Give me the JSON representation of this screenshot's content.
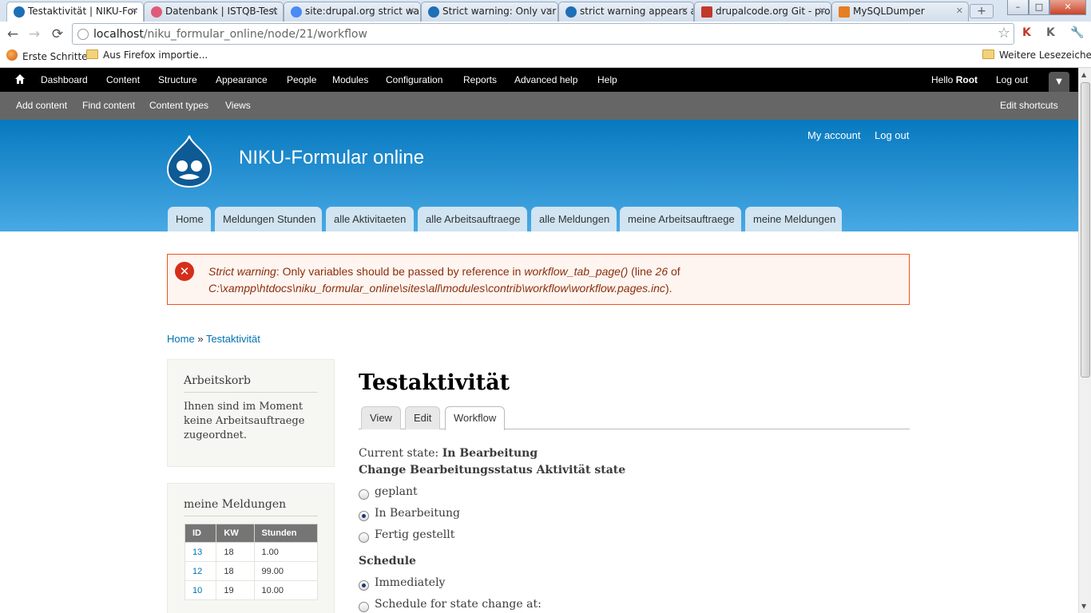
{
  "browser": {
    "tabs": [
      {
        "title": "Testaktivität | NIKU-For",
        "color": "#1e6fb5",
        "active": true
      },
      {
        "title": "Datenbank | ISTQB-Test",
        "color": "#e05a7a",
        "active": false
      },
      {
        "title": "site:drupal.org strict wa",
        "color": "#4a8af4",
        "active": false
      },
      {
        "title": "Strict warning: Only var",
        "color": "#1e6fb5",
        "active": false
      },
      {
        "title": "strict warning appears a",
        "color": "#1e6fb5",
        "active": false
      },
      {
        "title": "drupalcode.org Git - pro",
        "color": "#c0392b",
        "active": false
      },
      {
        "title": "MySQLDumper",
        "color": "#e67e22",
        "active": false
      }
    ],
    "new_tab": "+",
    "window": {
      "minimize": "–",
      "maximize": "□",
      "close": "✕"
    },
    "nav": {
      "back": "←",
      "forward": "→",
      "reload": "⟳"
    },
    "address": {
      "host": "localhost",
      "path": "/niku_formular_online/node/21/workflow"
    },
    "bookmarks": [
      "Erste Schritte",
      "Aus Firefox importie...",
      "Weitere Lesezeichen"
    ]
  },
  "admin_toolbar": {
    "items": [
      "Dashboard",
      "Content",
      "Structure",
      "Appearance",
      "People",
      "Modules",
      "Configuration",
      "Reports",
      "Advanced help",
      "Help"
    ],
    "hello": "Hello",
    "user": "Root",
    "logout": "Log out",
    "shortcuts": [
      "Add content",
      "Find content",
      "Content types",
      "Views"
    ],
    "edit_shortcuts": "Edit shortcuts"
  },
  "site": {
    "name": "NIKU-Formular online",
    "secondary_menu": [
      "My account",
      "Log out"
    ],
    "main_menu": [
      "Home",
      "Meldungen Stunden",
      "alle Aktivitaeten",
      "alle Arbeitsauftraege",
      "alle Meldungen",
      "meine Arbeitsauftraege",
      "meine Meldungen"
    ]
  },
  "message": {
    "type_label": "Strict warning",
    "text1": ": Only variables should be passed by reference in ",
    "func": "workflow_tab_page()",
    "text2": " (line ",
    "line": "26",
    "text3": " of",
    "file": "C:\\xampp\\htdocs\\niku_formular_online\\sites\\all\\modules\\contrib\\workflow\\workflow.pages.inc",
    "text4": ")."
  },
  "breadcrumb": {
    "home": "Home",
    "sep": "»",
    "current": "Testaktivität"
  },
  "sidebar": {
    "arbeitskorb": {
      "title": "Arbeitskorb",
      "body": "Ihnen sind im Moment keine Arbeitsauftraege zugeordnet."
    },
    "meldungen": {
      "title": "meine Meldungen",
      "headers": [
        "ID",
        "KW",
        "Stunden"
      ],
      "rows": [
        [
          "13",
          "18",
          "1.00"
        ],
        [
          "12",
          "18",
          "99.00"
        ],
        [
          "10",
          "19",
          "10.00"
        ]
      ]
    }
  },
  "node": {
    "title": "Testaktivität",
    "tabs": [
      "View",
      "Edit",
      "Workflow"
    ],
    "current_state_label": "Current state:",
    "current_state": "In Bearbeitung",
    "change_label": "Change Bearbeitungsstatus Aktivität state",
    "states": [
      {
        "label": "geplant",
        "checked": false
      },
      {
        "label": "In Bearbeitung",
        "checked": true
      },
      {
        "label": "Fertig gestellt",
        "checked": false
      }
    ],
    "schedule_label": "Schedule",
    "schedule_options": [
      {
        "label": "Immediately",
        "checked": true
      },
      {
        "label": "Schedule for state change at:",
        "checked": false
      }
    ]
  }
}
